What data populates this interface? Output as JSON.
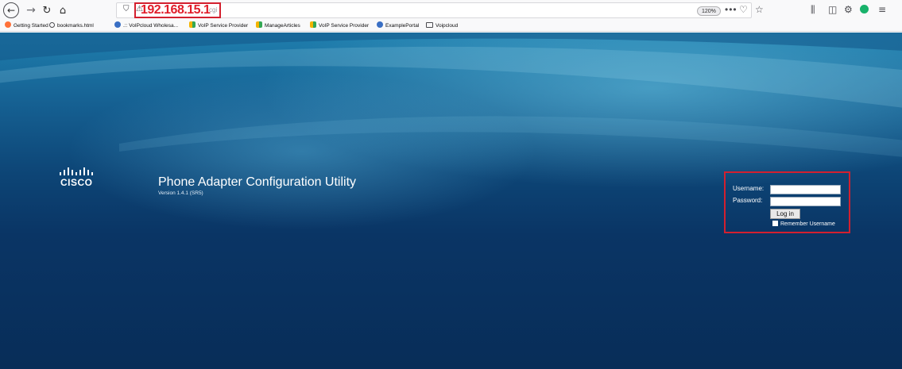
{
  "browser": {
    "nav": {
      "back_icon": "←",
      "forward_icon": "→",
      "reload_icon": "↻",
      "home_icon": "⌂"
    },
    "url": {
      "host": "192.168.15.1",
      "suffix": "cgi",
      "zoom": "120%",
      "page_actions_icon": "•••"
    },
    "bookmarks": [
      {
        "label": "Getting Started",
        "icon": "firefox-icon"
      },
      {
        "label": "bookmarks.html",
        "icon": "globe-icon"
      },
      {
        "label": ".:: VoIPcloud Wholesa...",
        "icon": "voipcloud-icon"
      },
      {
        "label": "VoIP Service Provider",
        "icon": "leaf-icon"
      },
      {
        "label": "ManageArticles",
        "icon": "leaf-icon"
      },
      {
        "label": "VoIP Service Provider",
        "icon": "leaf-icon"
      },
      {
        "label": "ExamplePortal",
        "icon": "voipcloud-icon"
      },
      {
        "label": "Voipcloud",
        "icon": "folder-icon"
      }
    ]
  },
  "brand": {
    "name": "CISCO",
    "logo_bars": "·ıı·ıı·"
  },
  "app": {
    "title": "Phone Adapter Configuration Utility",
    "version": "Version 1.4.1 (SR5)"
  },
  "login": {
    "username_label": "Username:",
    "password_label": "Password:",
    "username_value": "",
    "password_value": "",
    "button_label": "Log in",
    "remember_label": "Remember Username",
    "remember_checked": false
  },
  "colors": {
    "highlight": "#d3202f",
    "background_top": "#1f7fae",
    "background_bottom": "#082d58"
  }
}
